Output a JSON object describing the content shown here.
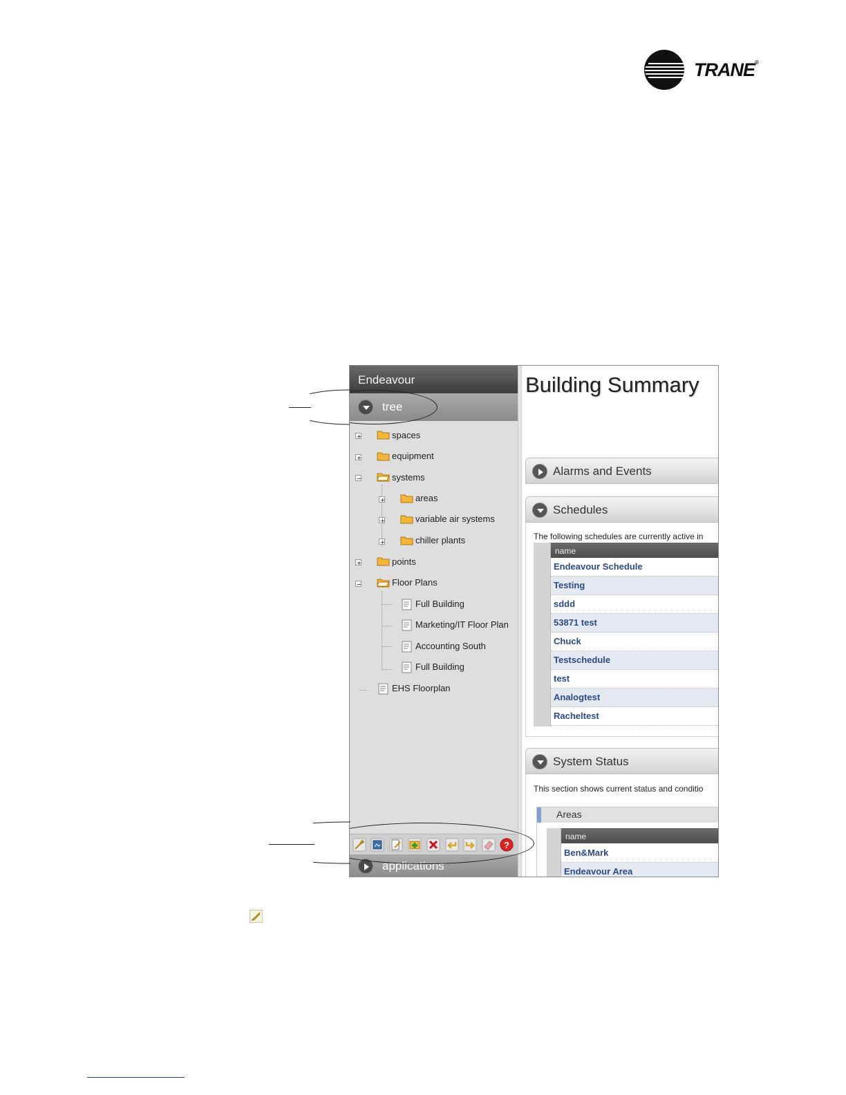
{
  "brand": {
    "logo_text": "TRANE",
    "registered_mark": "®"
  },
  "screenshot": {
    "sidebar": {
      "title": "Endeavour",
      "tree_header": "tree",
      "tree": {
        "spaces": "spaces",
        "equipment": "equipment",
        "systems": "systems",
        "areas": "areas",
        "variable_air_systems": "variable air systems",
        "chiller_plants": "chiller plants",
        "points": "points",
        "floor_plans": "Floor Plans",
        "full_building_1": "Full Building",
        "marketing_it": "Marketing/IT Floor Plan",
        "accounting_south": "Accounting South",
        "full_building_2": "Full Building",
        "ehs_floorplan": "EHS Floorplan"
      },
      "toolbar_icons": [
        "link-icon",
        "image-icon",
        "edit-icon",
        "add-icon",
        "delete-icon",
        "undo-icon",
        "redo-icon",
        "eraser-icon",
        "help-icon"
      ],
      "applications_header": "applications"
    },
    "main": {
      "title": "Building Summary",
      "alarms": {
        "header": "Alarms and Events"
      },
      "schedules": {
        "header": "Schedules",
        "description": "The following schedules are currently active in",
        "column": "name",
        "rows": [
          "Endeavour Schedule",
          "Testing",
          "sddd",
          "53871 test",
          "Chuck",
          "Testschedule",
          "test",
          "Analogtest",
          "Racheltest"
        ]
      },
      "system_status": {
        "header": "System Status",
        "description": "This section shows current status and conditio",
        "areas": {
          "title": "Areas",
          "column": "name",
          "rows": [
            "Ben&Mark",
            "Endeavour Area"
          ]
        }
      }
    }
  },
  "colors": {
    "link": "#2b4a8a",
    "row_alt": "#e4e9f2",
    "accent": "#7ea0d2"
  }
}
